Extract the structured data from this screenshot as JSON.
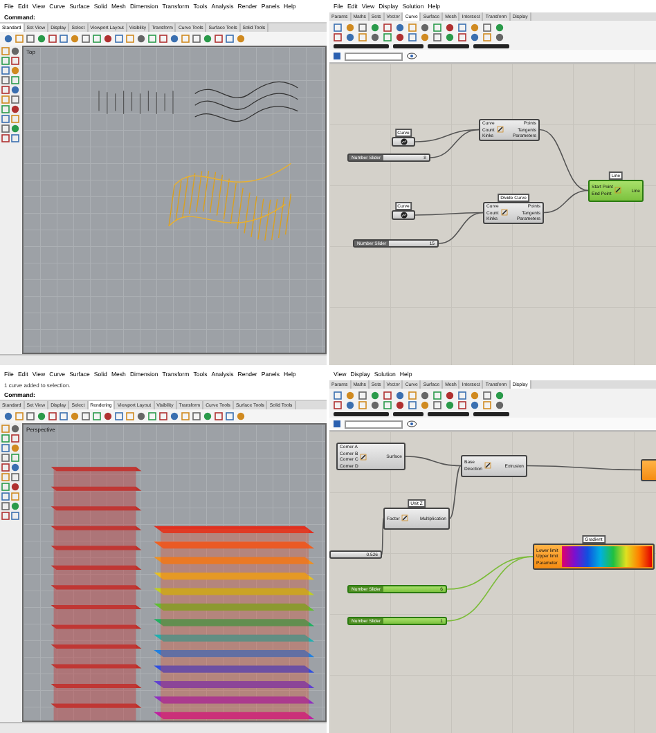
{
  "panels": [
    {
      "kind": "rhino",
      "menu": [
        "File",
        "Edit",
        "View",
        "Curve",
        "Surface",
        "Solid",
        "Mesh",
        "Dimension",
        "Transform",
        "Tools",
        "Analysis",
        "Render",
        "Panels",
        "Help"
      ],
      "command": "Command:",
      "tabs": [
        {
          "label": "Standard",
          "selected": true
        },
        {
          "label": "Set View",
          "selected": false
        },
        {
          "label": "Display",
          "selected": false
        },
        {
          "label": "Select",
          "selected": false
        },
        {
          "label": "Viewport Layout",
          "selected": false
        },
        {
          "label": "Visibility",
          "selected": false
        },
        {
          "label": "Transform",
          "selected": false
        },
        {
          "label": "Curve Tools",
          "selected": false
        },
        {
          "label": "Surface Tools",
          "selected": false
        },
        {
          "label": "Solid Tools",
          "selected": false
        }
      ],
      "viewport": {
        "kind": "curves",
        "label": "Top"
      }
    },
    {
      "kind": "grasshopper",
      "menu": [
        "File",
        "Edit",
        "View",
        "Display",
        "Solution",
        "Help"
      ],
      "tabs": [
        {
          "label": "Params",
          "selected": false
        },
        {
          "label": "Maths",
          "selected": false
        },
        {
          "label": "Sets",
          "selected": false
        },
        {
          "label": "Vector",
          "selected": false
        },
        {
          "label": "Curve",
          "selected": true
        },
        {
          "label": "Surface",
          "selected": false
        },
        {
          "label": "Mesh",
          "selected": false
        },
        {
          "label": "Intersect",
          "selected": false
        },
        {
          "label": "Transform",
          "selected": false
        },
        {
          "label": "Display",
          "selected": false
        }
      ],
      "nodes": [
        {
          "kind": "param",
          "tag": "Curve",
          "selected": false,
          "warning": false
        },
        {
          "kind": "slider",
          "label": "Number Slider",
          "value": "8",
          "selected": false,
          "warning": false
        },
        {
          "kind": "component",
          "inputs": [
            "Curve",
            "Count",
            "Kinks"
          ],
          "outputs": [
            "Points",
            "Tangents",
            "Parameters"
          ],
          "selected": false,
          "warning": false
        },
        {
          "kind": "component",
          "tag": "Line",
          "inputs": [
            "Start Point",
            "End Point"
          ],
          "outputs": [
            "Line"
          ],
          "selected": true,
          "warning": false
        },
        {
          "kind": "param",
          "tag": "Curve",
          "selected": false,
          "warning": false
        },
        {
          "kind": "slider",
          "label": "Number Slider",
          "value": "15",
          "selected": false,
          "warning": false
        },
        {
          "kind": "component",
          "tag": "Divide Curve",
          "inputs": [
            "Curve",
            "Count",
            "Kinks"
          ],
          "outputs": [
            "Points",
            "Tangents",
            "Parameters"
          ],
          "selected": false,
          "warning": false
        }
      ]
    },
    {
      "kind": "rhino",
      "menu": [
        "File",
        "Edit",
        "View",
        "Curve",
        "Surface",
        "Solid",
        "Mesh",
        "Dimension",
        "Transform",
        "Tools",
        "Analysis",
        "Render",
        "Panels",
        "Help"
      ],
      "history": [
        "1 curve added to selection."
      ],
      "command": "Command:",
      "tabs": [
        {
          "label": "Standard",
          "selected": false
        },
        {
          "label": "Set View",
          "selected": false
        },
        {
          "label": "Display",
          "selected": false
        },
        {
          "label": "Select",
          "selected": false
        },
        {
          "label": "Rendering",
          "selected": true
        },
        {
          "label": "Viewport Layout",
          "selected": false
        },
        {
          "label": "Visibility",
          "selected": false
        },
        {
          "label": "Transform",
          "selected": false
        },
        {
          "label": "Curve Tools",
          "selected": false
        },
        {
          "label": "Surface Tools",
          "selected": false
        },
        {
          "label": "Solid Tools",
          "selected": false
        }
      ],
      "viewport": {
        "kind": "floors",
        "label": "Perspective"
      }
    },
    {
      "kind": "grasshopper",
      "menu": [
        "View",
        "Display",
        "Solution",
        "Help"
      ],
      "tabs": [
        {
          "label": "Params",
          "selected": false
        },
        {
          "label": "Maths",
          "selected": false
        },
        {
          "label": "Sets",
          "selected": false
        },
        {
          "label": "Vector",
          "selected": false
        },
        {
          "label": "Curve",
          "selected": false
        },
        {
          "label": "Surface",
          "selected": false
        },
        {
          "label": "Mesh",
          "selected": false
        },
        {
          "label": "Intersect",
          "selected": false
        },
        {
          "label": "Transform",
          "selected": false
        },
        {
          "label": "Display",
          "selected": true
        }
      ],
      "nodes": [
        {
          "kind": "component",
          "inputs": [
            "Corner A",
            "Corner B",
            "Corner C",
            "Corner D"
          ],
          "outputs": [
            "Surface"
          ],
          "selected": false,
          "warning": false
        },
        {
          "kind": "component",
          "inputs": [
            "Base",
            "Direction"
          ],
          "outputs": [
            "Extrusion"
          ],
          "selected": false,
          "warning": false
        },
        {
          "kind": "component",
          "tag": "Unit Z",
          "inputs": [
            "Factor"
          ],
          "outputs": [
            "Multiplication"
          ],
          "selected": false,
          "warning": false
        },
        {
          "kind": "slider",
          "value": "0.526",
          "selected": false,
          "warning": false
        },
        {
          "kind": "slider",
          "label": "Number Slider",
          "value": "6",
          "selected": true,
          "warning": false
        },
        {
          "kind": "slider",
          "label": "Number Slider",
          "value": "1",
          "selected": true,
          "warning": false
        },
        {
          "kind": "gradient",
          "tag": "Gradient",
          "inputs": [
            "Lower limit",
            "Upper limit",
            "Parameter"
          ],
          "selected": false,
          "warning": true
        },
        {
          "kind": "component",
          "selected": false,
          "warning": true
        }
      ]
    }
  ]
}
